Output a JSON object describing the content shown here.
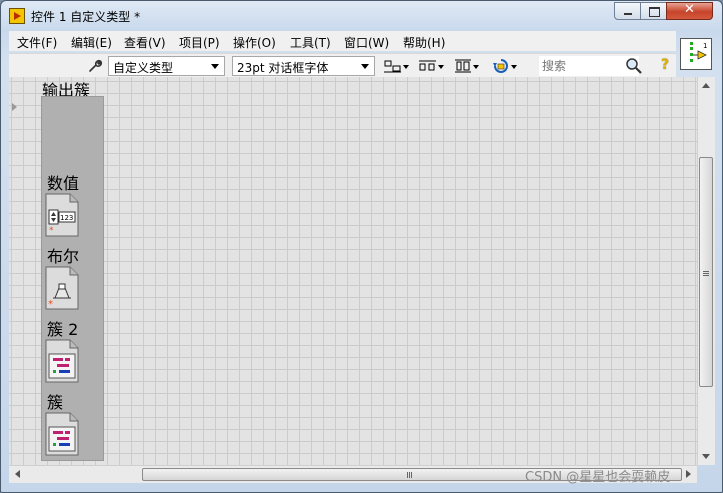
{
  "window": {
    "title": "控件 1 自定义类型 *",
    "close_label": "✕"
  },
  "menu": [
    {
      "label": "文件(F)"
    },
    {
      "label": "编辑(E)"
    },
    {
      "label": "查看(V)"
    },
    {
      "label": "项目(P)"
    },
    {
      "label": "操作(O)"
    },
    {
      "label": "工具(T)"
    },
    {
      "label": "窗口(W)"
    },
    {
      "label": "帮助(H)"
    }
  ],
  "toolbar": {
    "control_type": "自定义类型",
    "font": "23pt 对话框字体",
    "search_placeholder": "搜索",
    "help_label": "?",
    "connector_number": "1"
  },
  "panel": {
    "cluster_label": "输出簇",
    "items": [
      {
        "label": "数值",
        "icon": "numeric-control-icon"
      },
      {
        "label": "布尔",
        "icon": "boolean-control-icon"
      },
      {
        "label": "簇 2",
        "icon": "cluster-icon"
      },
      {
        "label": "簇",
        "icon": "cluster-icon"
      }
    ]
  },
  "watermark": "CSDN @星星也会耍赖皮",
  "colors": {
    "grid_bg": "#e3e3e3",
    "grid_line": "#cbcbcb",
    "cluster_bg": "#b0b0b0"
  }
}
